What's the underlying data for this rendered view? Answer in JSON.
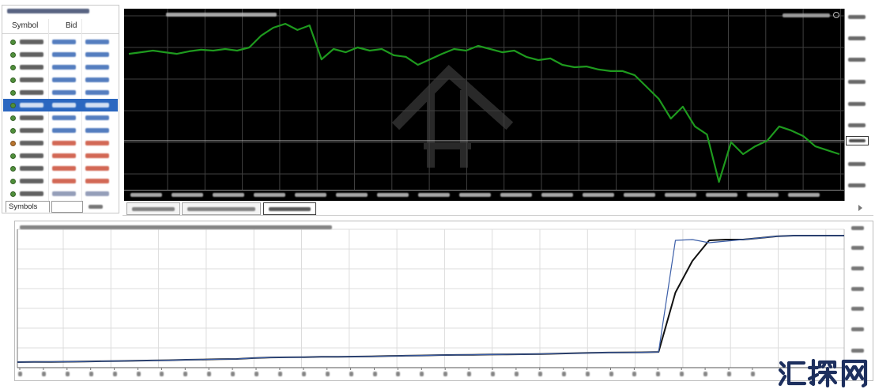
{
  "market_watch": {
    "columns": [
      "Symbol",
      "Bid"
    ],
    "rows": [
      {
        "icon": "circle-icon",
        "icon_color": "#4f8f3a",
        "price_color": "#2a5db0",
        "selected": false
      },
      {
        "icon": "circle-icon",
        "icon_color": "#4f8f3a",
        "price_color": "#2a5db0",
        "selected": false
      },
      {
        "icon": "circle-icon",
        "icon_color": "#4f8f3a",
        "price_color": "#2a5db0",
        "selected": false
      },
      {
        "icon": "circle-icon",
        "icon_color": "#4f8f3a",
        "price_color": "#2a5db0",
        "selected": false
      },
      {
        "icon": "circle-icon",
        "icon_color": "#4f8f3a",
        "price_color": "#2a5db0",
        "selected": false
      },
      {
        "icon": "circle-icon",
        "icon_color": "#4f8f3a",
        "price_color": "#2a5db0",
        "selected": true
      },
      {
        "icon": "circle-icon",
        "icon_color": "#4f8f3a",
        "price_color": "#2a5db0",
        "selected": false
      },
      {
        "icon": "circle-icon",
        "icon_color": "#4f8f3a",
        "price_color": "#2a5db0",
        "selected": false
      },
      {
        "icon": "circle-icon",
        "icon_color": "#b8742e",
        "price_color": "#c8432b",
        "selected": false
      },
      {
        "icon": "circle-icon",
        "icon_color": "#4f8f3a",
        "price_color": "#c8432b",
        "selected": false
      },
      {
        "icon": "circle-icon",
        "icon_color": "#4f8f3a",
        "price_color": "#c8432b",
        "selected": false
      },
      {
        "icon": "circle-icon",
        "icon_color": "#4f8f3a",
        "price_color": "#c8432b",
        "selected": false
      },
      {
        "icon": "circle-icon",
        "icon_color": "#4f8f3a",
        "price_color": "#7a86a8",
        "selected": false
      }
    ],
    "tabs": [
      {
        "label": "Symbols",
        "active": true
      },
      {
        "label": "",
        "active": false
      },
      {
        "label": "",
        "active": false
      }
    ]
  },
  "chart_tabs": [
    {
      "active": false
    },
    {
      "active": false
    },
    {
      "active": true
    }
  ],
  "colors": {
    "chart_background": "#000000",
    "price_line": "#1e9a1e",
    "grid": "#3f3f3f",
    "current_price_line": "#9a9a9a",
    "selected_row": "#2b67c0",
    "equity_line": "#111111",
    "balance_line": "#3b5ea8",
    "watermark": "#1d2f5e"
  },
  "watermark": "汇探网",
  "chart_data": [
    {
      "type": "line",
      "ylim": [
        0,
        100
      ],
      "current_level": 27.6,
      "series": [
        {
          "values": [
            76.4,
            77.3,
            78.2,
            77.3,
            76.4,
            77.8,
            78.7,
            78.2,
            79.1,
            78.2,
            80.0,
            86.7,
            91.1,
            93.3,
            89.8,
            92.4,
            73.3,
            79.1,
            77.3,
            80.0,
            78.2,
            79.1,
            75.6,
            74.7,
            70.2,
            73.3,
            76.4,
            79.1,
            78.2,
            80.9,
            79.1,
            77.3,
            78.2,
            74.7,
            72.9,
            73.8,
            70.2,
            68.9,
            69.3,
            67.6,
            66.7,
            66.7,
            64.4,
            57.8,
            51.1,
            40.0,
            46.7,
            35.6,
            31.1,
            4.4,
            26.7,
            20.0,
            24.4,
            27.6,
            35.6,
            33.3,
            30.2,
            24.4,
            22.2,
            20.0
          ]
        }
      ]
    },
    {
      "type": "line",
      "ylim": [
        0,
        100
      ],
      "series": [
        {
          "values": [
            4.0,
            4.1,
            4.2,
            4.3,
            4.4,
            4.6,
            4.8,
            5.0,
            5.2,
            5.4,
            5.7,
            5.9,
            6.1,
            6.3,
            6.9,
            7.4,
            7.5,
            7.6,
            7.8,
            7.9,
            8.0,
            8.2,
            8.4,
            8.6,
            8.8,
            9.1,
            9.2,
            9.3,
            9.5,
            9.6,
            9.7,
            9.9,
            10.2,
            10.4,
            10.7,
            10.9,
            11.0,
            11.1,
            11.4,
            54.3,
            77.1,
            92.0,
            92.6,
            92.6,
            93.7,
            94.9,
            95.4,
            95.4,
            95.4,
            95.4
          ]
        },
        {
          "values": [
            4.0,
            4.1,
            4.2,
            4.3,
            4.4,
            4.6,
            4.8,
            5.0,
            5.2,
            5.4,
            5.7,
            5.9,
            6.1,
            6.3,
            6.9,
            7.4,
            7.5,
            7.6,
            7.8,
            7.9,
            8.0,
            8.2,
            8.4,
            8.6,
            8.8,
            9.1,
            9.2,
            9.3,
            9.5,
            9.6,
            9.7,
            9.9,
            10.2,
            10.4,
            10.7,
            10.9,
            11.0,
            11.1,
            11.4,
            92.0,
            92.6,
            90.3,
            91.4,
            92.6,
            93.7,
            94.9,
            95.4,
            95.4,
            95.4,
            95.4
          ]
        }
      ]
    }
  ]
}
